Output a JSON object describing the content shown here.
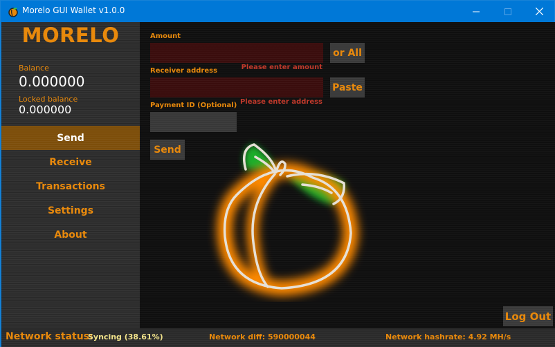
{
  "window": {
    "title": "Morelo GUI Wallet v1.0.0",
    "icon": "peach-app-icon",
    "controls": {
      "minimize": "minimize-icon",
      "maximize": "maximize-icon",
      "close": "close-icon"
    }
  },
  "sidebar": {
    "logo": "MORELO",
    "balance_label": "Balance",
    "balance_value": "0.000000",
    "locked_label": "Locked balance",
    "locked_value": "0.000000",
    "items": [
      {
        "label": "Send",
        "active": true
      },
      {
        "label": "Receive",
        "active": false
      },
      {
        "label": "Transactions",
        "active": false
      },
      {
        "label": "Settings",
        "active": false
      },
      {
        "label": "About",
        "active": false
      }
    ]
  },
  "send_form": {
    "amount": {
      "label": "Amount",
      "value": "",
      "placeholder": "",
      "error": "Please enter amount",
      "button": "or All"
    },
    "receiver": {
      "label": "Receiver address",
      "value": "",
      "placeholder": "",
      "error": "Please enter address",
      "button": "Paste"
    },
    "payment_id": {
      "label": "Payment ID (Optional)",
      "value": "",
      "placeholder": ""
    },
    "send_button": "Send",
    "background_art": "peach-logo"
  },
  "logout_button": "Log Out",
  "status": {
    "label": "Network status:",
    "value": "Syncing (38.61%)",
    "sync_percent": 38.61,
    "network_diff": "Network diff: 590000044",
    "network_hashrate": "Network hashrate: 4.92 MH/s"
  },
  "colors": {
    "accent": "#e8890c",
    "active_nav": "#7d4e0a",
    "error": "#c0392b",
    "titlebar": "#0078d7",
    "status_value": "#f1e28a"
  }
}
